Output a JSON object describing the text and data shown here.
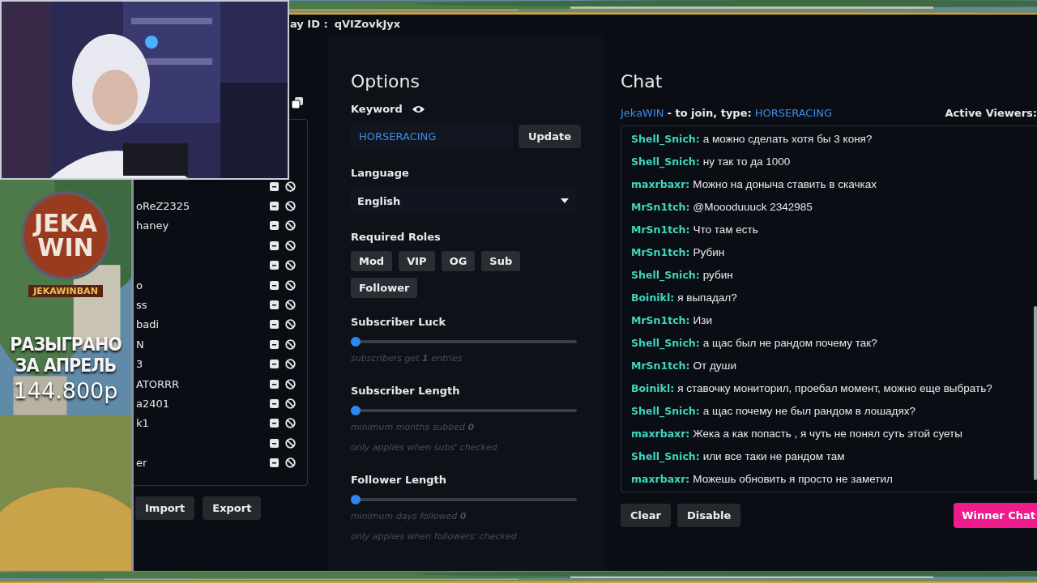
{
  "banner": {
    "logo_top": "JEKA",
    "logo_bottom": "WIN",
    "handle": "JEKAWINBAN",
    "caption_lines": [
      "РАЗЫГРАНО",
      "ЗА АПРЕЛЬ"
    ],
    "amount": "144.800р"
  },
  "header": {
    "label": "ay ID :",
    "value": "qVIZovkJyx"
  },
  "entries": [
    {
      "kind": "blank"
    },
    {
      "kind": "named",
      "name": "oReZ2325"
    },
    {
      "kind": "named",
      "name": "haney"
    },
    {
      "kind": "blank"
    },
    {
      "kind": "blank"
    },
    {
      "kind": "named",
      "name": "o"
    },
    {
      "kind": "named",
      "name": "ss"
    },
    {
      "kind": "named",
      "name": "badi"
    },
    {
      "kind": "named",
      "name": "N"
    },
    {
      "kind": "named",
      "name": "3"
    },
    {
      "kind": "named",
      "name": "ATORRR"
    },
    {
      "kind": "named",
      "name": "a2401"
    },
    {
      "kind": "named",
      "name": "k1"
    },
    {
      "kind": "blank"
    },
    {
      "kind": "named",
      "name": "er"
    }
  ],
  "entry_buttons": [
    "Import",
    "Export"
  ],
  "options": {
    "title": "Options",
    "keyword_label": "Keyword",
    "keyword_value": "HORSERACING",
    "update_button": "Update",
    "language_label": "Language",
    "language_value": "English",
    "roles_label": "Required Roles",
    "roles": [
      "Mod",
      "VIP",
      "OG",
      "Sub",
      "Follower"
    ],
    "sliders": [
      {
        "label": "Subscriber Luck",
        "level": 0,
        "notes": [
          {
            "text": "subscribers get ",
            "value": "1",
            "tail": " entries"
          }
        ]
      },
      {
        "label": "Subscriber Length",
        "level": 0,
        "notes": [
          {
            "text": "minimum months subbed ",
            "value": "0"
          },
          {
            "text": "only applies when subs' checked"
          }
        ]
      },
      {
        "label": "Follower Length",
        "level": 0,
        "notes": [
          {
            "text": "minimum days followed ",
            "value": "0"
          },
          {
            "text": "only applies when followers' checked"
          }
        ]
      }
    ]
  },
  "chat": {
    "title": "Chat",
    "channel": "JekaWIN",
    "join_text": "- to join, type:",
    "join_keyword": "HORSERACING",
    "viewers_label": "Active Viewers:",
    "messages": [
      {
        "user": "Shell_Snich:",
        "text": "а можно сделать хотя бы 3 коня?"
      },
      {
        "user": "Shell_Snich:",
        "text": "ну так то да 1000"
      },
      {
        "user": "maxrbaxr:",
        "text": "Можно на доныча ставить в скачках"
      },
      {
        "user": "MrSn1tch:",
        "text": "@Moooduuuck 2342985"
      },
      {
        "user": "MrSn1tch:",
        "text": "Что там есть"
      },
      {
        "user": "MrSn1tch:",
        "text": "Рубин"
      },
      {
        "user": "Shell_Snich:",
        "text": "рубин"
      },
      {
        "user": "Boinikl:",
        "text": "я выпадал?"
      },
      {
        "user": "MrSn1tch:",
        "text": "Изи"
      },
      {
        "user": "Shell_Snich:",
        "text": "а щас был не рандом почему так?"
      },
      {
        "user": "MrSn1tch:",
        "text": "От души"
      },
      {
        "user": "Boinikl:",
        "text": "я ставочку мониторил, проебал момент, можно еще выбрать?"
      },
      {
        "user": "Shell_Snich:",
        "text": "а щас почему не был рандом в лошадях?"
      },
      {
        "user": "maxrbaxr:",
        "text": "Жека а как попасть , я чуть не понял суть этой суеты"
      },
      {
        "user": "Shell_Snich:",
        "text": "или все таки не рандом там"
      },
      {
        "user": "maxrbaxr:",
        "text": "Можешь обновить я просто не заметил"
      }
    ],
    "buttons": [
      "Clear",
      "Disable"
    ],
    "winner_button": "Winner Chat"
  }
}
